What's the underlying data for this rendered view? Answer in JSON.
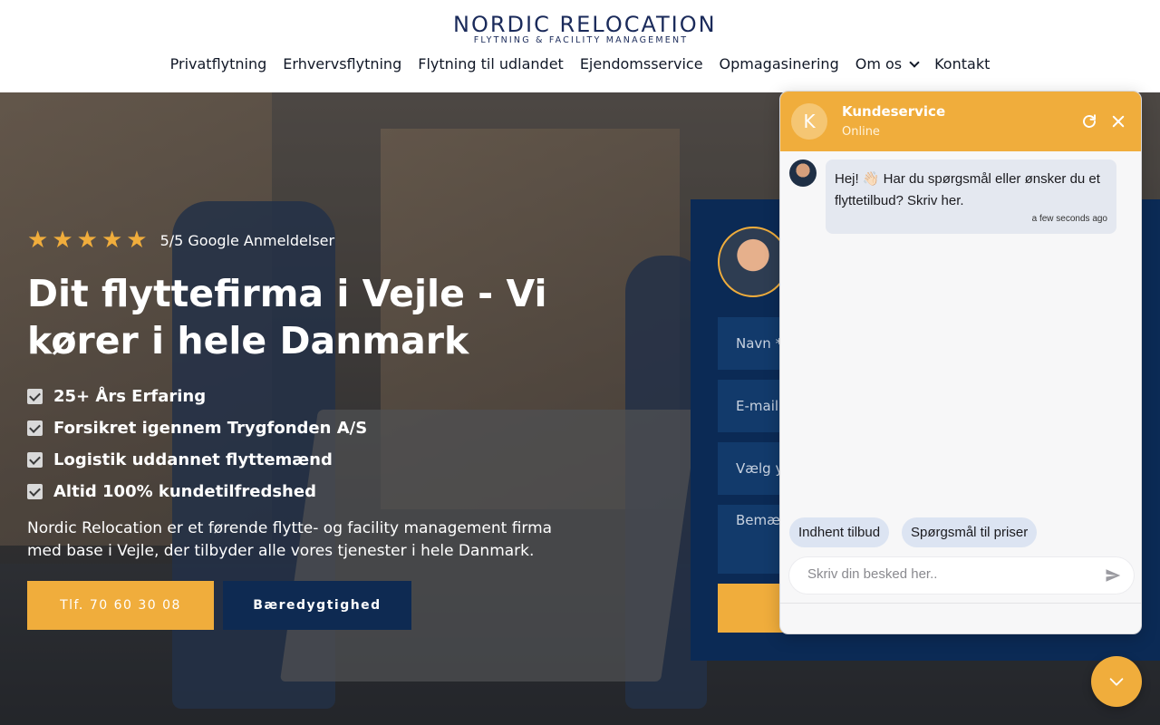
{
  "brand": {
    "name": "NORDIC RELOCATION",
    "tagline": "FLYTNING & FACILITY MANAGEMENT"
  },
  "nav": {
    "items": [
      {
        "label": "Privatflytning"
      },
      {
        "label": "Erhvervsflytning"
      },
      {
        "label": "Flytning til udlandet"
      },
      {
        "label": "Ejendomsservice"
      },
      {
        "label": "Opmagasinering"
      },
      {
        "label": "Om os",
        "icon": "chevron-down-icon"
      },
      {
        "label": "Kontakt"
      }
    ]
  },
  "hero": {
    "rating": {
      "stars": 5,
      "text": "5/5 Google Anmeldelser"
    },
    "title": "Dit flyttefirma i Vejle - Vi kører i hele Danmark",
    "benefits": [
      "25+ Års Erfaring",
      "Forsikret igennem Trygfonden A/S",
      "Logistik uddannet flyttemænd",
      "Altid 100% kundetilfredshed"
    ],
    "description": "Nordic Relocation er et førende flytte- og facility management firma med base i Vejle, der tilbyder alle vores tjenester i hele Danmark.",
    "phone_button": "Tlf. 70 60 30 08",
    "sustain_button": "Bæredygtighed"
  },
  "form": {
    "name_placeholder": "Navn *",
    "email_placeholder": "E-mail",
    "select_placeholder": "Vælg y",
    "message_placeholder": "Bemæ"
  },
  "chat": {
    "agent_initial": "K",
    "title": "Kundeservice",
    "status": "Online",
    "message": "Hej! 👋🏻 Har du spørgsmål eller ønsker du et flyttetilbud? Skriv her.",
    "message_time": "a few seconds ago",
    "quick_replies": [
      "Indhent tilbud",
      "Spørgsmål til priser"
    ],
    "input_placeholder": "Skriv din besked her.."
  },
  "colors": {
    "accent": "#f0ad3c",
    "navy": "#0b2a55",
    "brand_text": "#1a2a5a"
  }
}
